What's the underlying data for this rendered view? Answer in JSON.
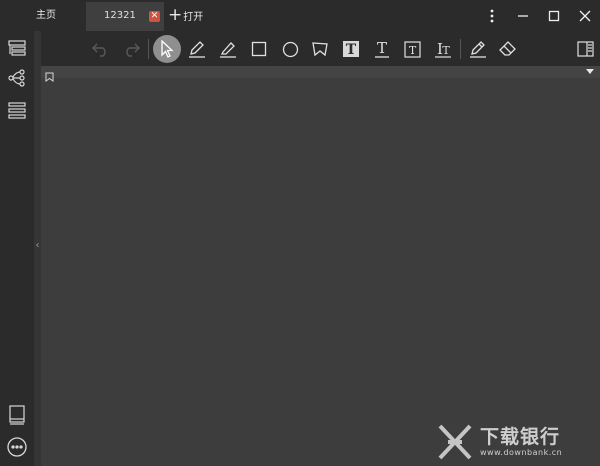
{
  "tabs": {
    "home_label": "主页",
    "doc_label": "12321",
    "close_glyph": "✕",
    "open_label": "打开",
    "plus_glyph": "+"
  },
  "window_controls": [
    "more-vertical-icon",
    "minimize-icon",
    "maximize-icon",
    "close-icon"
  ],
  "sidebar": {
    "top_icons": [
      "outline-icon",
      "mindmap-icon",
      "list-icon"
    ],
    "bottom_icons": [
      "book-icon",
      "more-icon"
    ],
    "collapse_glyph": "‹"
  },
  "toolbar": {
    "tools": [
      "undo-icon",
      "redo-icon",
      "select-icon",
      "pen-icon",
      "highlighter-icon",
      "rectangle-icon",
      "ellipse-icon",
      "polygon-icon",
      "text-filled-icon",
      "text-underline-icon",
      "text-box-icon",
      "text-style-icon",
      "edit-icon",
      "eraser-icon",
      "panel-toggle-icon"
    ],
    "active_tool": "select-icon"
  },
  "watermark": {
    "cn": "下载银行",
    "url": "www.downbank.cn"
  },
  "colors": {
    "background": "#2b2b2b",
    "canvas": "#3d3d3d",
    "tab_active": "#3f3f3f",
    "close_red": "#d0533f",
    "active_tool_bg": "#8f8f8f"
  }
}
